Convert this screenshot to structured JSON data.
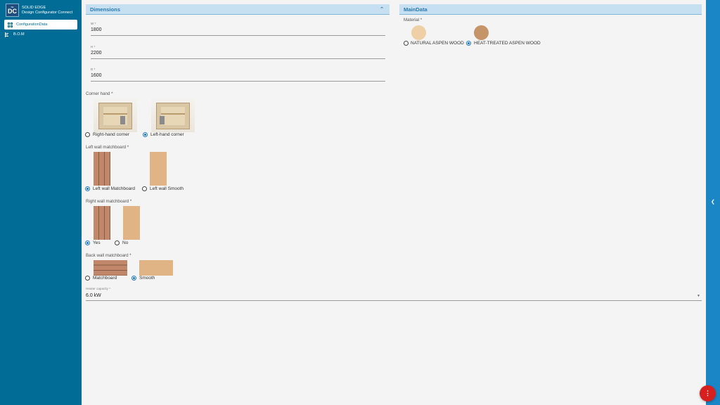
{
  "app": {
    "logo_top": "SE",
    "logo_text": "DC",
    "brand_line1": "SOLID EDGE",
    "brand_line2": "Design Configurator Connect"
  },
  "sidebar": {
    "items": [
      {
        "label": "ConfigurationData",
        "icon": "grid-icon",
        "active": true
      },
      {
        "label": "B.O.M",
        "icon": "tree-icon",
        "active": false
      }
    ]
  },
  "dimensions": {
    "title": "Dimensions",
    "fields": [
      {
        "label": "W *",
        "value": "1800"
      },
      {
        "label": "H *",
        "value": "2200"
      },
      {
        "label": "D *",
        "value": "1600"
      }
    ],
    "corner_hand": {
      "label": "Corner hand *",
      "options": [
        {
          "label": "Right-hand corner",
          "selected": false
        },
        {
          "label": "Left-hand corner",
          "selected": true
        }
      ]
    },
    "left_wall": {
      "label": "Left wall matchboard *",
      "options": [
        {
          "label": "Left wall Matchboard",
          "selected": true
        },
        {
          "label": "Left wall Smooth",
          "selected": false
        }
      ]
    },
    "right_wall": {
      "label": "Right wall matchboard *",
      "options": [
        {
          "label": "Yes",
          "selected": true
        },
        {
          "label": "No",
          "selected": false
        }
      ]
    },
    "back_wall": {
      "label": "Back wall matchboard *",
      "options": [
        {
          "label": "Matchboard",
          "selected": false
        },
        {
          "label": "Smooth",
          "selected": true
        }
      ]
    },
    "heater": {
      "label": "Heater capacity *",
      "value": "6.0 kW"
    }
  },
  "main_data": {
    "title": "MainData",
    "material": {
      "label": "Material *",
      "options": [
        {
          "label": "NATURAL ASPEN WOOD",
          "selected": false,
          "color": "#efcfa6"
        },
        {
          "label": "HEAT-TREATED ASPEN WOOD",
          "selected": true,
          "color": "#c59468"
        }
      ]
    }
  },
  "colors": {
    "sidebar": "#016c95",
    "header_bg": "#c6dff1",
    "accent": "#1f78c6",
    "fab": "#d62020"
  }
}
